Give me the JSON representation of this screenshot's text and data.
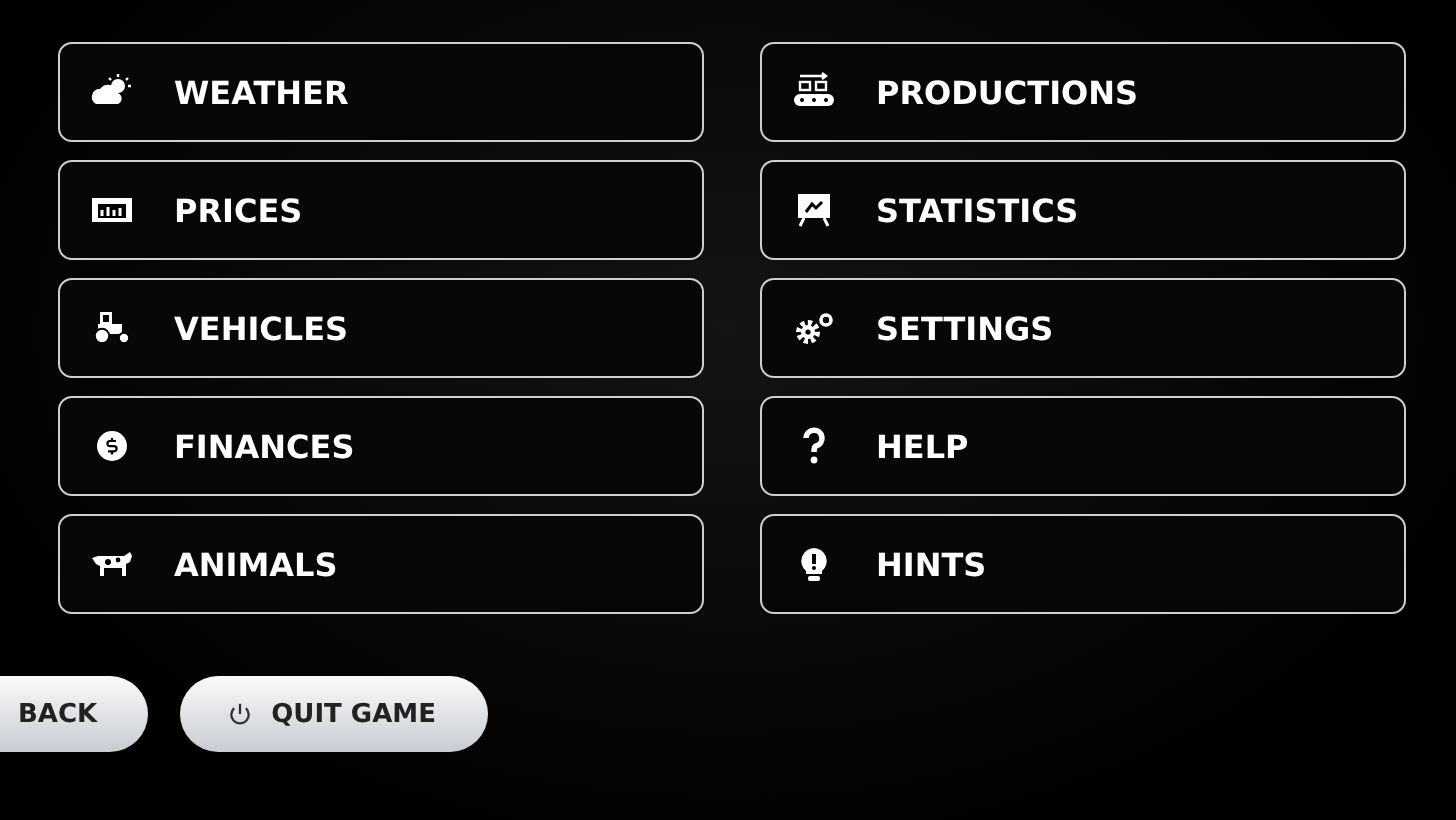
{
  "menu_columns": [
    [
      {
        "label": "WEATHER",
        "kind": "weather"
      },
      {
        "label": "PRICES",
        "kind": "prices"
      },
      {
        "label": "VEHICLES",
        "kind": "tractor"
      },
      {
        "label": "FINANCES",
        "kind": "coin"
      },
      {
        "label": "ANIMALS",
        "kind": "cow"
      }
    ],
    [
      {
        "label": "PRODUCTIONS",
        "kind": "conveyor"
      },
      {
        "label": "STATISTICS",
        "kind": "board"
      },
      {
        "label": "SETTINGS",
        "kind": "gears"
      },
      {
        "label": "HELP",
        "kind": "question"
      },
      {
        "label": "HINTS",
        "kind": "bulb"
      }
    ]
  ],
  "bottom_buttons": [
    {
      "label": "BACK",
      "kind": "plain"
    },
    {
      "label": "QUIT GAME",
      "kind": "power"
    }
  ]
}
